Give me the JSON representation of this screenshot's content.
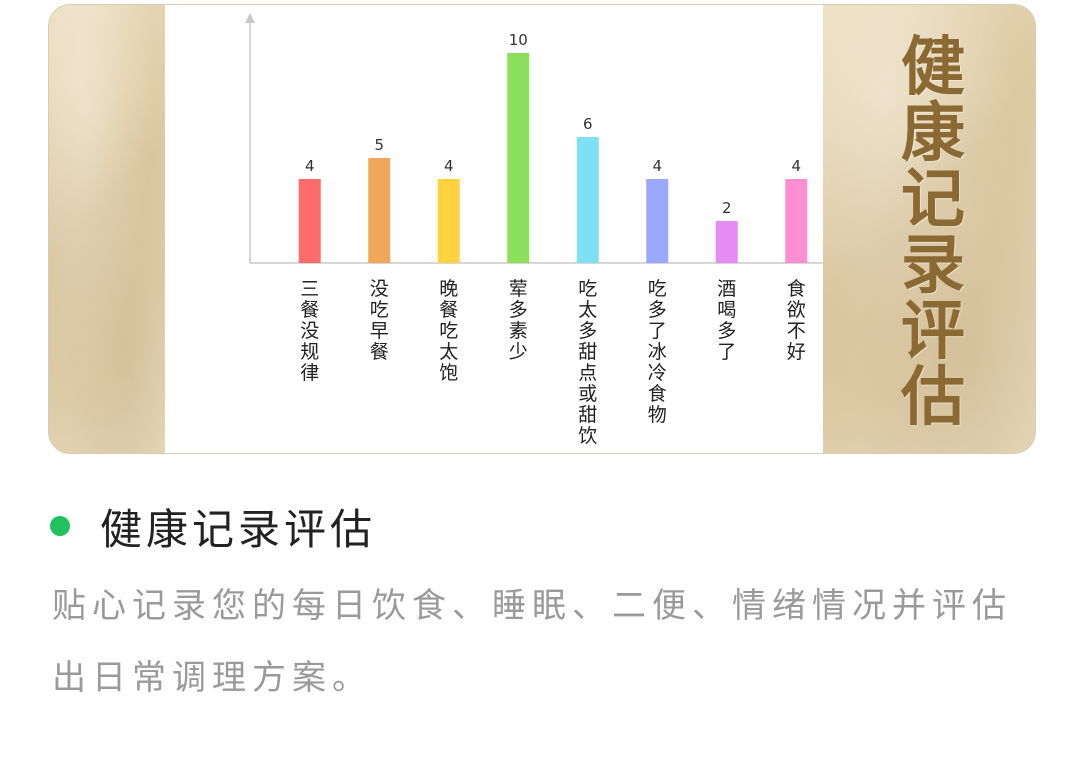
{
  "banner": {
    "vertical_title": "健康记录评估"
  },
  "chart_data": {
    "type": "bar",
    "categories": [
      "三餐没规律",
      "没吃早餐",
      "晚餐吃太饱",
      "荤多素少",
      "吃太多甜点或甜饮",
      "吃多了冰冷食物",
      "酒喝多了",
      "食欲不好"
    ],
    "values": [
      4,
      5,
      4,
      10,
      6,
      4,
      2,
      4
    ],
    "colors": [
      "#ff6b6b",
      "#f0a75a",
      "#ffd23f",
      "#8be05c",
      "#7fe0f3",
      "#9aa8ff",
      "#e48cf2",
      "#ff8fd2"
    ],
    "ylim": [
      0,
      10
    ],
    "grid": false
  },
  "section": {
    "title": "健康记录评估",
    "description": "贴心记录您的每日饮食、睡眠、二便、情绪情况并评估出日常调理方案。",
    "accent_color": "#21c15f"
  }
}
